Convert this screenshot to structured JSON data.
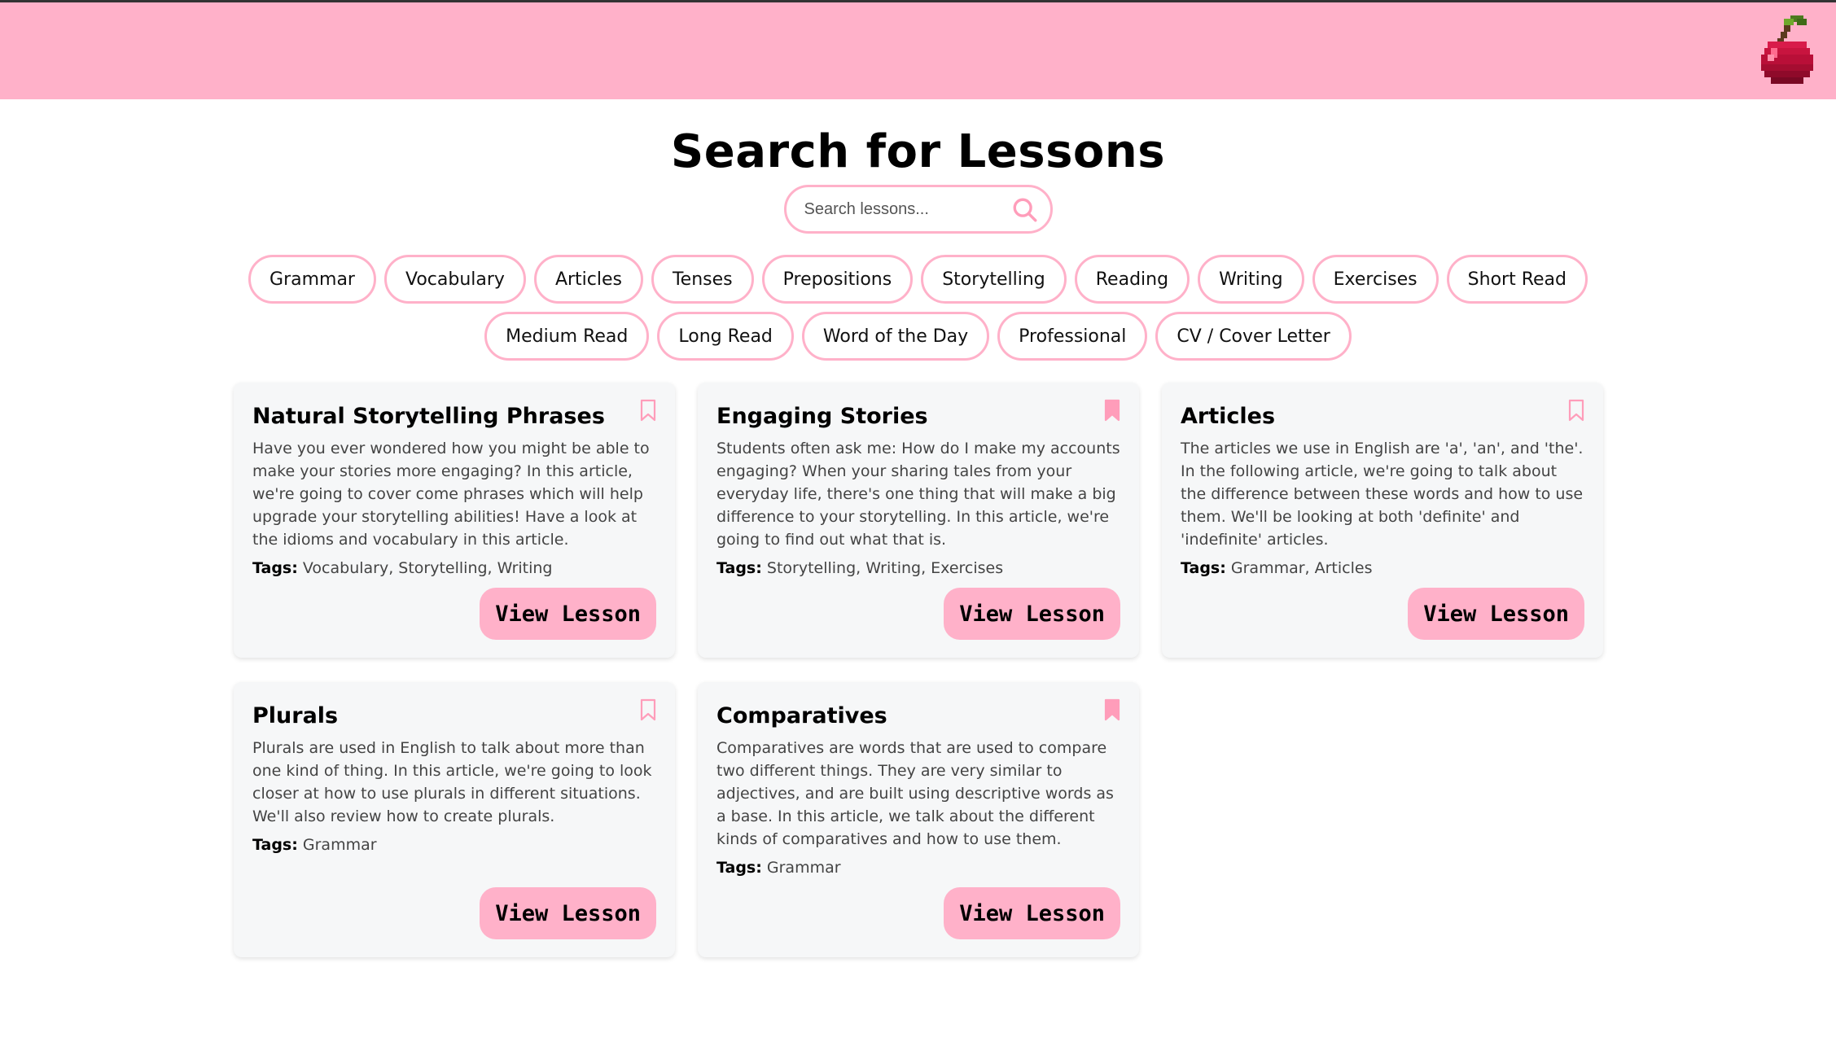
{
  "header": {
    "logo_icon": "cherry-icon",
    "background_color": "#ffb1c9"
  },
  "main": {
    "title": "Search for Lessons",
    "search": {
      "placeholder": "Search lessons...",
      "value": "",
      "icon": "search-icon"
    },
    "filter_tags": [
      "Grammar",
      "Vocabulary",
      "Articles",
      "Tenses",
      "Prepositions",
      "Storytelling",
      "Reading",
      "Writing",
      "Exercises",
      "Short Read",
      "Medium Read",
      "Long Read",
      "Word of the Day",
      "Professional",
      "CV / Cover Letter"
    ],
    "tags_label": "Tags:",
    "view_button_label": "View Lesson",
    "lessons": [
      {
        "title": "Natural Storytelling Phrases",
        "description": "Have you ever wondered how you might be able to make your stories more engaging? In this article, we're going to cover come phrases which will help upgrade your storytelling abilities! Have a look at the idioms and vocabulary in this article.",
        "tags": "Vocabulary, Storytelling, Writing",
        "bookmarked": false
      },
      {
        "title": "Engaging Stories",
        "description": "Students often ask me: How do I make my accounts engaging? When your sharing tales from your everyday life, there's one thing that will make a big difference to your storytelling. In this article, we're going to find out what that is.",
        "tags": "Storytelling, Writing, Exercises",
        "bookmarked": true
      },
      {
        "title": "Articles",
        "description": "The articles we use in English are 'a', 'an', and 'the'. In the following article, we're going to talk about the difference between these words and how to use them. We'll be looking at both 'definite' and 'indefinite' articles.",
        "tags": "Grammar, Articles",
        "bookmarked": false
      },
      {
        "title": "Plurals",
        "description": "Plurals are used in English to talk about more than one kind of thing. In this article, we're going to look closer at how to use plurals in different situations. We'll also review how to create plurals.",
        "tags": "Grammar",
        "bookmarked": false
      },
      {
        "title": "Comparatives",
        "description": "Comparatives are words that are used to compare two different things. They are very similar to adjectives, and are built using descriptive words as a base. In this article, we talk about the different kinds of comparatives and how to use them.",
        "tags": "Grammar",
        "bookmarked": true
      }
    ]
  }
}
